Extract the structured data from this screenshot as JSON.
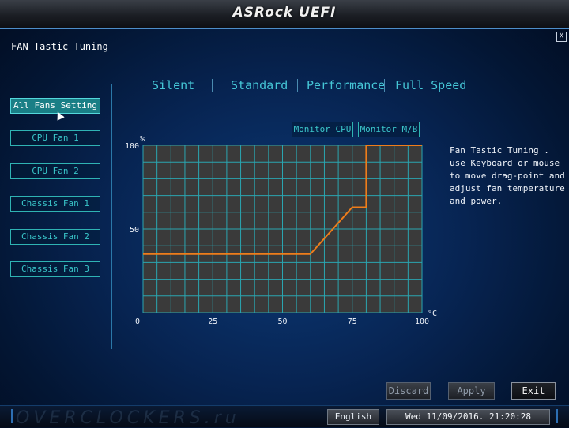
{
  "app": {
    "brand": "ASRock UEFI"
  },
  "page": {
    "title": "FAN-Tastic Tuning",
    "close_label": "X"
  },
  "sidebar": {
    "items": [
      {
        "label": "All Fans Setting",
        "active": true
      },
      {
        "label": "CPU Fan 1",
        "active": false
      },
      {
        "label": "CPU Fan 2",
        "active": false
      },
      {
        "label": "Chassis Fan 1",
        "active": false
      },
      {
        "label": "Chassis Fan 2",
        "active": false
      },
      {
        "label": "Chassis Fan 3",
        "active": false
      }
    ]
  },
  "modes": [
    "Silent",
    "Standard",
    "Performance",
    "Full Speed"
  ],
  "monitor": {
    "cpu_label": "Monitor CPU",
    "mb_label": "Monitor M/B"
  },
  "help": {
    "text": "Fan Tastic Tuning . use Keyboard or mouse to move drag-point and adjust fan temperature and power."
  },
  "chart_data": {
    "type": "line",
    "xlabel": "°C",
    "ylabel": "%",
    "xlim": [
      0,
      100
    ],
    "ylim": [
      0,
      100
    ],
    "x_ticks": [
      0,
      25,
      50,
      75,
      100
    ],
    "y_ticks": [
      50,
      100
    ],
    "grid": true,
    "series": [
      {
        "points": [
          [
            0,
            35
          ],
          [
            60,
            35
          ],
          [
            75,
            63
          ],
          [
            80,
            63
          ],
          [
            80,
            100
          ],
          [
            100,
            100
          ]
        ]
      }
    ],
    "colors": {
      "line": "#ef7d1a",
      "grid": "#2aa5b0",
      "plot_bg": "#3a3a3a"
    }
  },
  "actions": {
    "discard": "Discard",
    "apply": "Apply",
    "exit": "Exit"
  },
  "status": {
    "language": "English",
    "datetime": "Wed 11/09/2016. 21:20:28"
  },
  "watermark": "OVERCLOCKERS.ru"
}
